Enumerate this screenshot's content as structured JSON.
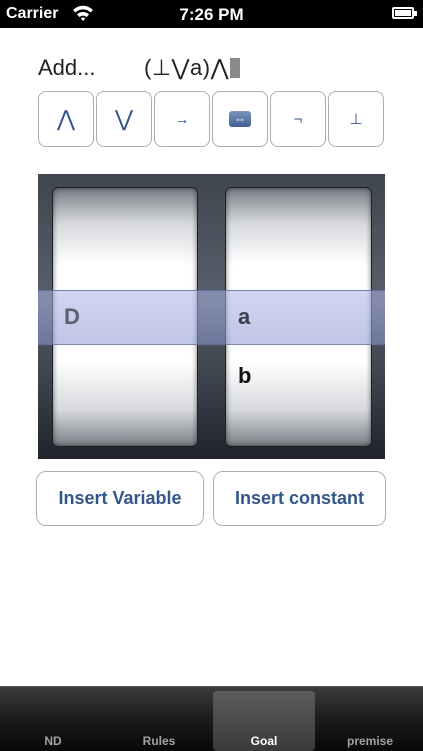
{
  "status_bar": {
    "carrier": "Carrier",
    "time": "7:26 PM"
  },
  "editor": {
    "add_label": "Add...",
    "formula": "(⊥⋁a)⋀"
  },
  "operators": [
    {
      "symbol": "⋀",
      "name": "and"
    },
    {
      "symbol": "⋁",
      "name": "or"
    },
    {
      "symbol": "→",
      "name": "implies"
    },
    {
      "symbol": "⇔",
      "name": "iff"
    },
    {
      "symbol": "¬",
      "name": "not"
    },
    {
      "symbol": "⊥",
      "name": "bottom"
    }
  ],
  "picker": {
    "variables": {
      "selected": "D"
    },
    "constants": {
      "selected": "a",
      "next": "b"
    }
  },
  "buttons": {
    "insert_variable": "Insert Variable",
    "insert_constant": "Insert constant"
  },
  "tabs": [
    {
      "label": "ND",
      "active": false
    },
    {
      "label": "Rules",
      "active": false
    },
    {
      "label": "Goal",
      "active": true
    },
    {
      "label": "premise",
      "active": false
    }
  ],
  "colors": {
    "button_text": "#34558a",
    "button_border": "#a9b0bb",
    "selection_band": "#a0aadc"
  }
}
